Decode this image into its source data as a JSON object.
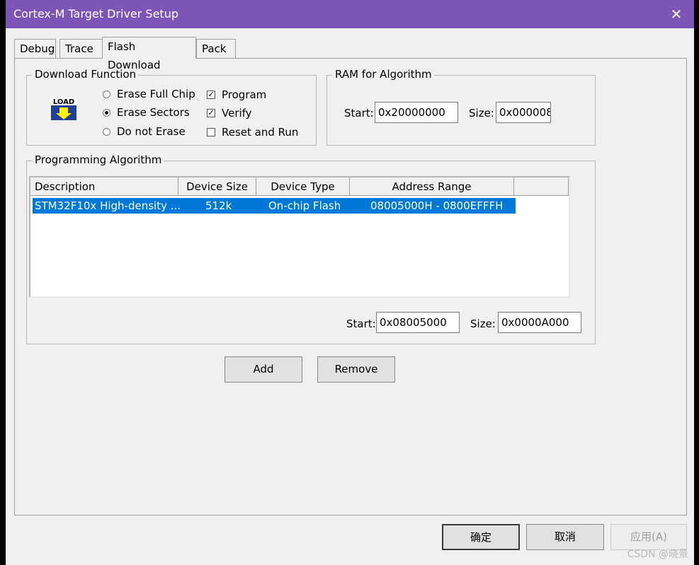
{
  "window": {
    "title": "Cortex-M Target Driver Setup"
  },
  "tabs": [
    {
      "label": "Debug"
    },
    {
      "label": "Trace"
    },
    {
      "label": "Flash Download"
    },
    {
      "label": "Pack"
    }
  ],
  "download_function": {
    "label": "Download Function",
    "icon_text": "LOAD",
    "erase_full_chip": "Erase Full Chip",
    "erase_sectors": "Erase Sectors",
    "do_not_erase": "Do not Erase",
    "selected_erase": "Erase Sectors",
    "program": "Program",
    "program_checked": true,
    "verify": "Verify",
    "verify_checked": true,
    "reset_and_run": "Reset and Run",
    "reset_checked": false
  },
  "ram": {
    "label": "RAM for Algorithm",
    "start_label": "Start:",
    "start_value": "0x20000000",
    "size_label": "Size:",
    "size_value": "0x000008"
  },
  "algorithm": {
    "label": "Programming Algorithm",
    "columns": [
      "Description",
      "Device Size",
      "Device Type",
      "Address Range"
    ],
    "rows": [
      {
        "description": "STM32F10x High-density ...",
        "size": "512k",
        "type": "On-chip Flash",
        "range": "08005000H - 0800EFFFH"
      }
    ],
    "start_label": "Start:",
    "start_value": "0x08005000",
    "size_label": "Size:",
    "size_value": "0x0000A000"
  },
  "buttons": {
    "add": "Add",
    "remove": "Remove",
    "ok": "确定",
    "cancel": "取消",
    "apply": "应用(A)"
  },
  "watermark": "CSDN @晓景"
}
